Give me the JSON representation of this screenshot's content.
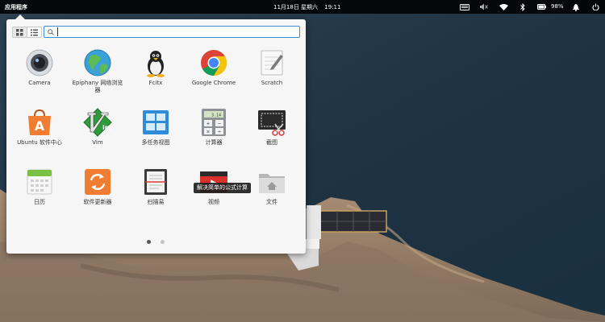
{
  "panel": {
    "apps_label": "应用程序",
    "date": "11月18日 星期六",
    "time": "19:11",
    "battery": "98%"
  },
  "launcher": {
    "search_placeholder": "",
    "tooltip": "解决简单的公式计算",
    "apps": [
      {
        "label": "Camera",
        "icon": "camera-icon"
      },
      {
        "label": "Epiphany 网络浏览器",
        "icon": "globe-icon"
      },
      {
        "label": "Fcitx",
        "icon": "penguin-icon"
      },
      {
        "label": "Google Chrome",
        "icon": "chrome-icon"
      },
      {
        "label": "Scratch",
        "icon": "notepad-icon"
      },
      {
        "label": "Ubuntu 软件中心",
        "icon": "shopping-bag-icon"
      },
      {
        "label": "Vim",
        "icon": "vim-icon"
      },
      {
        "label": "多任务视图",
        "icon": "multitask-icon"
      },
      {
        "label": "计算器",
        "icon": "calculator-icon"
      },
      {
        "label": "截图",
        "icon": "screenshot-icon"
      },
      {
        "label": "日历",
        "icon": "calendar-icon"
      },
      {
        "label": "软件更新器",
        "icon": "update-icon"
      },
      {
        "label": "扫描易",
        "icon": "scanner-icon"
      },
      {
        "label": "视频",
        "icon": "video-icon"
      },
      {
        "label": "文件",
        "icon": "folder-icon"
      }
    ],
    "calculator_display": "3.14",
    "page_count": 2,
    "current_page": 1
  },
  "colors": {
    "accent": "#3d8fd6",
    "panel_bg": "#000000"
  }
}
